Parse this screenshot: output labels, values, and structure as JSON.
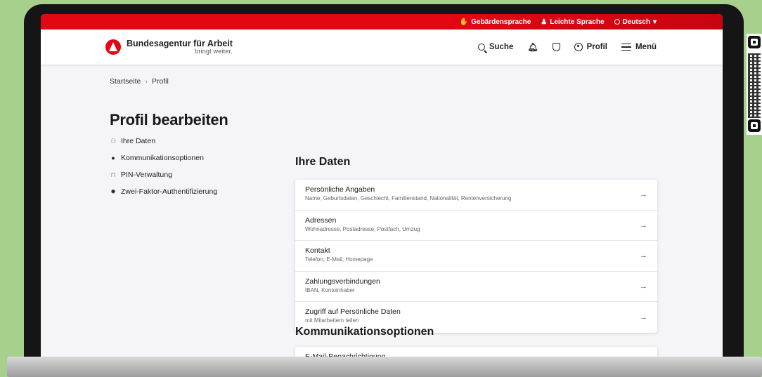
{
  "topbar": {
    "sign_language": "Gebärdensprache",
    "easy_language": "Leichte Sprache",
    "language": "Deutsch"
  },
  "header": {
    "logo_name": "Bundesagentur für Arbeit",
    "logo_tagline": "bringt weiter.",
    "search": "Suche",
    "profile": "Profil",
    "menu": "Menü"
  },
  "breadcrumb": {
    "home": "Startseite",
    "current": "Profil"
  },
  "page_title": "Profil bearbeiten",
  "sidenav": [
    {
      "label": "Ihre Daten",
      "icon": "person-icon"
    },
    {
      "label": "Kommunikationsoptionen",
      "icon": "bell-icon"
    },
    {
      "label": "PIN-Verwaltung",
      "icon": "lock-icon"
    },
    {
      "label": "Zwei-Faktor-Authentifizierung",
      "icon": "gear-icon"
    }
  ],
  "sections": {
    "data_title": "Ihre Daten",
    "data_rows": [
      {
        "title": "Persönliche Angaben",
        "subtitle": "Name, Geburtsdaten, Geschlecht, Familienstand, Nationalität, Rentenversicherung"
      },
      {
        "title": "Adressen",
        "subtitle": "Wohnadresse, Postadresse, Postfach, Umzug"
      },
      {
        "title": "Kontakt",
        "subtitle": "Telefon, E-Mail, Homepage"
      },
      {
        "title": "Zahlungsverbindungen",
        "subtitle": "IBAN, Kontoinhaber"
      },
      {
        "title": "Zugriff auf Persönliche Daten",
        "subtitle": "mit Mitarbeitern teilen"
      }
    ],
    "comm_title": "Kommunikationsoptionen",
    "comm_rows": [
      {
        "title": "E-Mail-Benachrichtigung"
      }
    ]
  },
  "colors": {
    "brand_red": "#e30613",
    "background": "#a8d08d"
  }
}
